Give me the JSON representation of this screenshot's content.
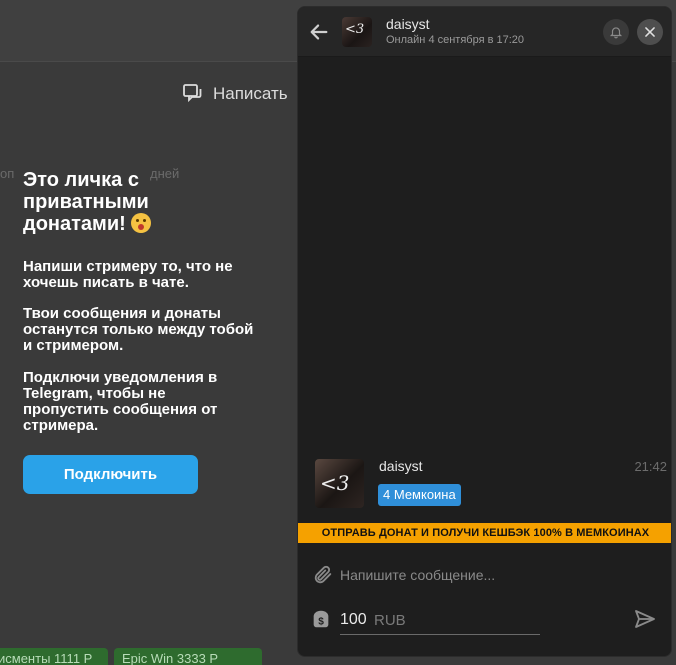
{
  "background": {
    "write_label": "Написать",
    "ghost_left": "оп",
    "ghost_right": "дней",
    "badges": [
      "исменты 1111 Р",
      "Epic Win 3333 Р"
    ]
  },
  "promo": {
    "title": "Это личка с приватными донатами!",
    "text1": "Напиши стримеру то, что не хочешь писать в чате.",
    "text2": "Твои сообщения и донаты останутся только между тобой и стримером.",
    "text3": "Подключи уведомления в Telegram, чтобы не пропустить сообщения от стримера.",
    "connect_label": "Подключить"
  },
  "chat": {
    "name": "daisyst",
    "status": "Онлайн 4 сентября в 17:20",
    "avatar_glyph": "<3",
    "message": {
      "author": "daisyst",
      "time": "21:42",
      "badge": "4 Мемкоина"
    },
    "promo_strip": "ОТПРАВЬ ДОНАТ И ПОЛУЧИ КЕШБЭК 100% В МЕМКОИНАХ",
    "input_placeholder": "Напишите сообщение...",
    "amount": "100",
    "currency": "RUB"
  },
  "colors": {
    "accent": "#2aa2e8",
    "badge_blue": "#2f8fd9",
    "strip": "#f5a100",
    "panel": "#1e1e1e"
  },
  "icons": [
    "write-icon",
    "emoji-icon",
    "back-arrow-icon",
    "bell-icon",
    "close-icon",
    "paperclip-icon",
    "money-icon",
    "send-icon"
  ]
}
